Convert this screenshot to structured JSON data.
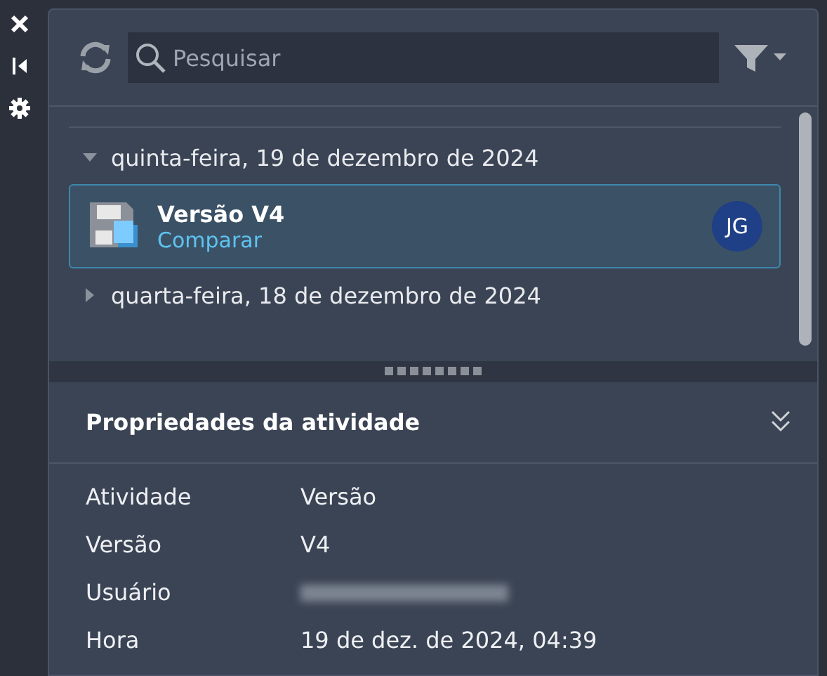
{
  "sidebar": {
    "buttons": [
      {
        "kind": "close"
      },
      {
        "kind": "dock"
      },
      {
        "kind": "settings"
      }
    ]
  },
  "toolbar": {
    "search": {
      "placeholder": "Pesquisar"
    }
  },
  "timeline": {
    "groups": [
      {
        "label": "quinta-feira, 19 de dezembro de 2024",
        "expanded": true,
        "items": [
          {
            "title": "Versão V4",
            "action": "Comparar",
            "avatar": "JG",
            "selected": true
          }
        ]
      },
      {
        "label": "quarta-feira, 18 de dezembro de 2024",
        "expanded": false
      }
    ]
  },
  "properties": {
    "title": "Propriedades da atividade",
    "expanded": true,
    "rows": [
      {
        "label": "Atividade",
        "value": "Versão"
      },
      {
        "label": "Versão",
        "value": "V4"
      },
      {
        "label": "Usuário",
        "value": null,
        "blurred": true
      },
      {
        "label": "Hora",
        "value": "19 de dez. de 2024, 04:39"
      }
    ]
  }
}
